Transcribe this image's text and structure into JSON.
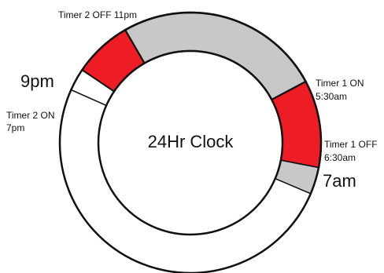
{
  "diagram": {
    "center_label": "24Hr Clock",
    "colors": {
      "timer_on": "#ee1c24",
      "timer_off": "#c8c8c8",
      "unshaded": "#ffffff",
      "outline": "#111111"
    },
    "labels": {
      "timer2_off": "Timer 2 OFF 11pm",
      "nine_pm": "9pm",
      "timer2_on_line1": "Timer 2 ON",
      "timer2_on_line2": "7pm",
      "timer1_on_line1": "Timer 1 ON",
      "timer1_on_line2": "5:30am",
      "timer1_off_line1": "Timer 1 OFF",
      "timer1_off_line2": "6:30am",
      "seven_am": "7am"
    }
  }
}
